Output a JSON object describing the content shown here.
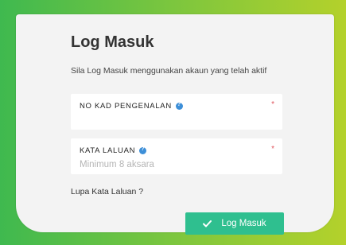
{
  "login": {
    "title": "Log Masuk",
    "subtitle": "Sila Log Masuk menggunakan akaun yang telah aktif",
    "fields": [
      {
        "label": "NO KAD PENGENALAN",
        "value": "",
        "placeholder": "",
        "required_mark": "*"
      },
      {
        "label": "KATA LALUAN",
        "value": "",
        "placeholder": "Minimum 8 aksara",
        "required_mark": "*"
      }
    ],
    "forgot_link": "Lupa Kata Laluan ?",
    "submit_label": "Log Masuk"
  },
  "colors": {
    "background_gradient": [
      "#3fb94f",
      "#b4d12b"
    ],
    "card": "#f3f3f3",
    "button": "#2fbf8f",
    "info_icon": "#3d8fd8",
    "required": "#e0555e"
  },
  "icons": {
    "info": "question-circle-icon",
    "submit": "check-icon"
  }
}
